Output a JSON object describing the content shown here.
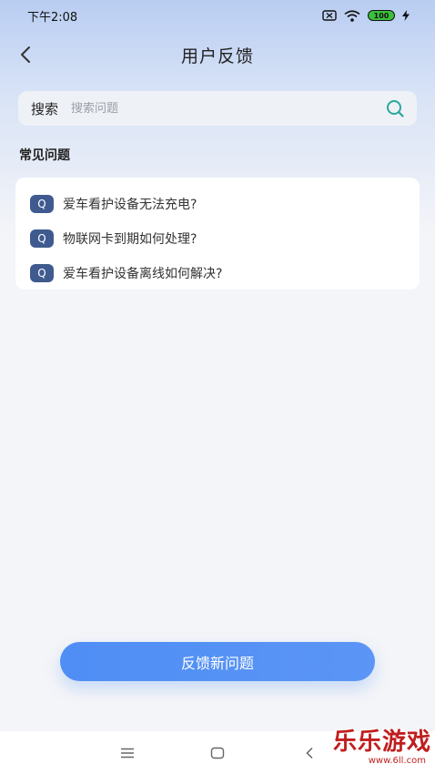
{
  "status_bar": {
    "time": "下午2:08",
    "battery": "100"
  },
  "header": {
    "title": "用户反馈"
  },
  "search": {
    "label": "搜索",
    "placeholder": "搜索问题"
  },
  "faq": {
    "section_title": "常见问题",
    "badge": "Q",
    "items": [
      "爱车看护设备无法充电?",
      "物联网卡到期如何处理?",
      "爱车看护设备离线如何解决?"
    ]
  },
  "actions": {
    "submit_label": "反馈新问题"
  },
  "watermark": {
    "main": "乐乐游戏",
    "url": "www.6ll.com"
  },
  "colors": {
    "accent": "#4f8ef5",
    "badge": "#3f5a8f",
    "watermark": "#c01e1e"
  }
}
